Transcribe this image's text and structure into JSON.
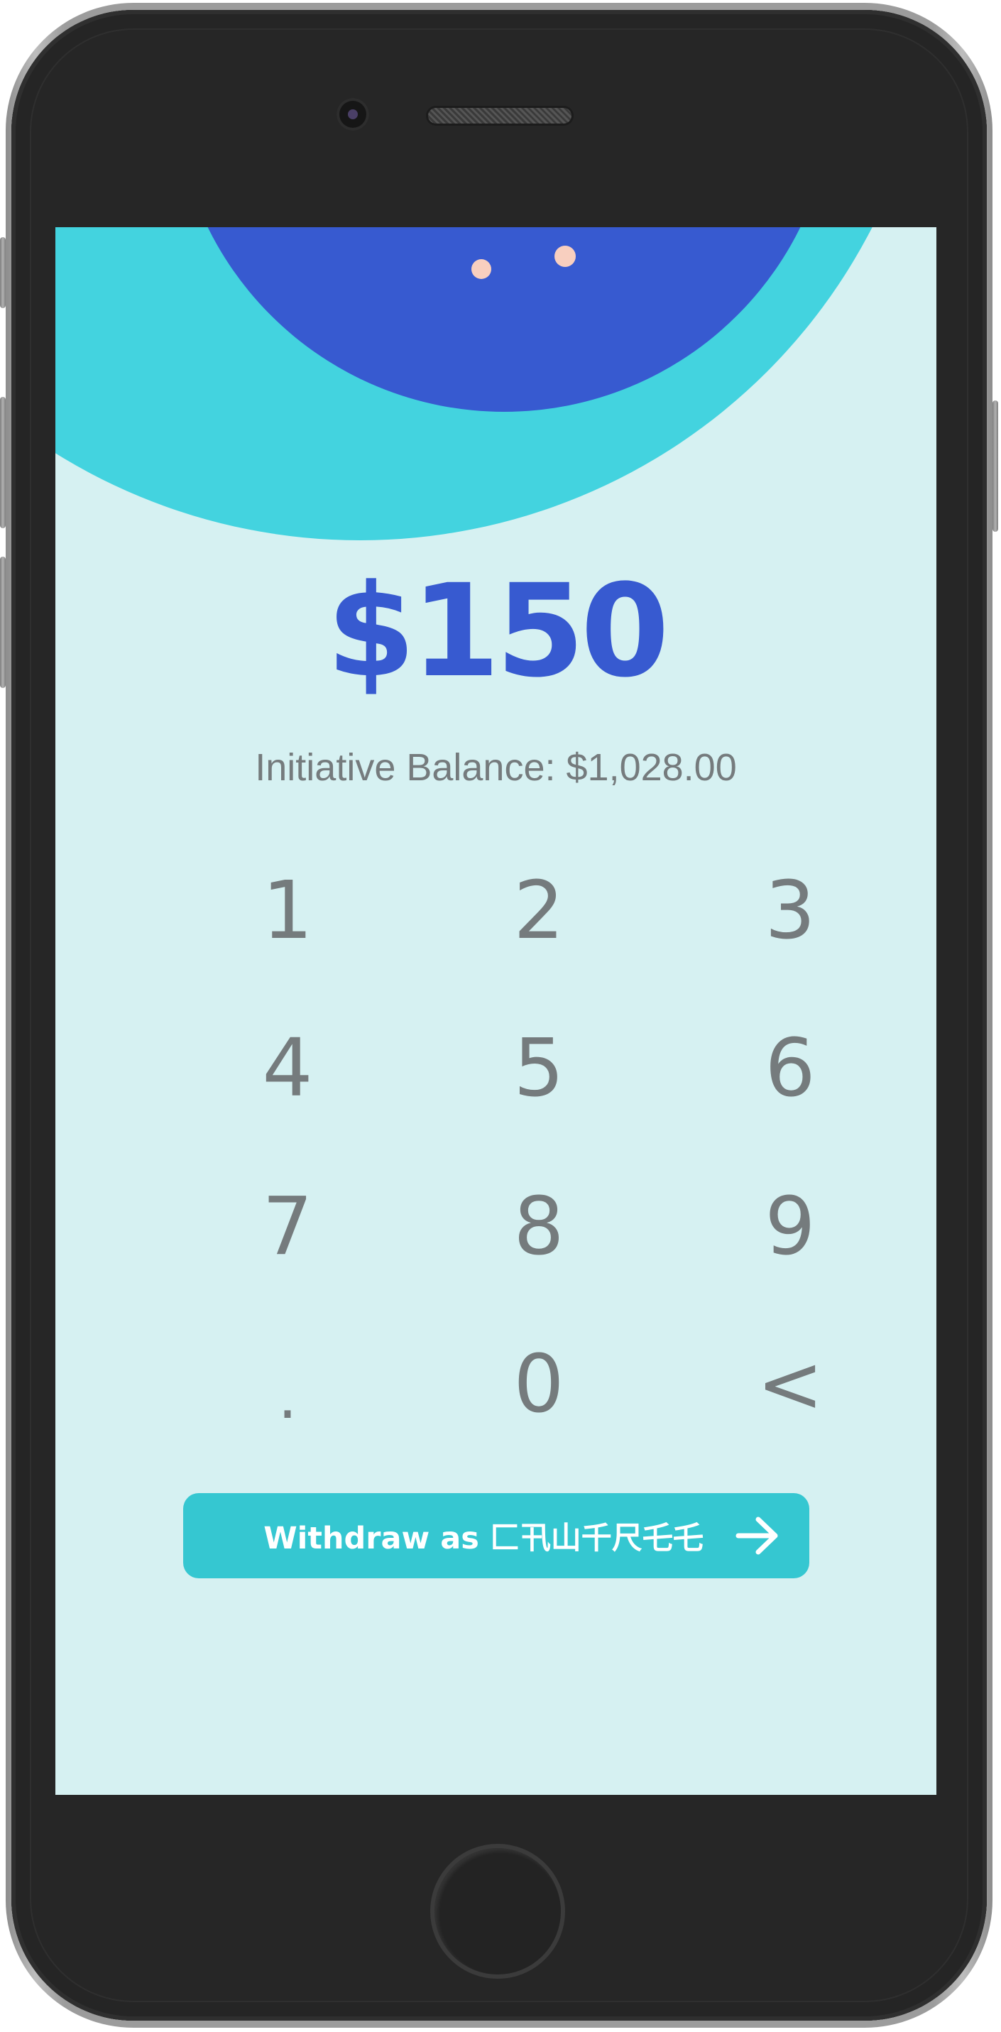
{
  "withdraw": {
    "amount": "$150",
    "balance_label": "Initiative Balance: $1,028.00",
    "keypad": {
      "keys": [
        "1",
        "2",
        "3",
        "4",
        "5",
        "6",
        "7",
        "8",
        "9",
        ".",
        "0",
        "<"
      ]
    },
    "button": {
      "label": "Withdraw as 匚卂山千尺乇乇",
      "icon": "arrow-right-icon"
    }
  },
  "colors": {
    "screen_background": "#d6f1f2",
    "hero_outer": "#43d3df",
    "hero_inner": "#375ad0",
    "hero_dots": "#f8cfbf",
    "amount": "#375ad0",
    "muted_text": "#757b7d",
    "button": "#35c7d1",
    "button_text": "#ffffff",
    "device_body": "#262626"
  }
}
